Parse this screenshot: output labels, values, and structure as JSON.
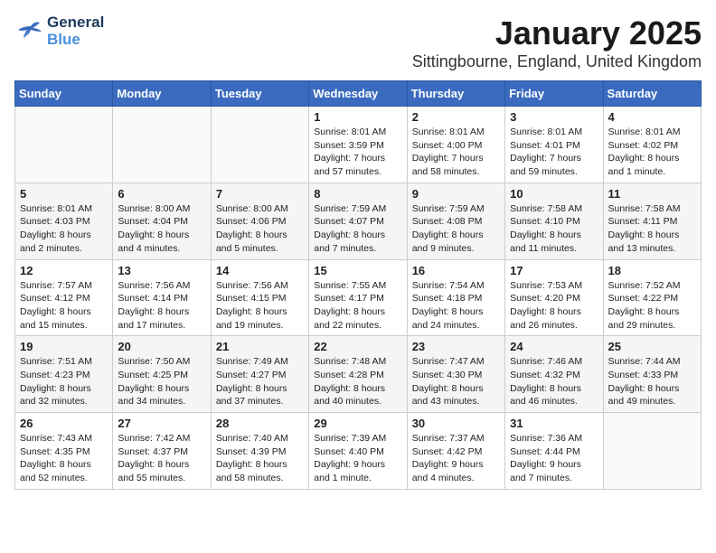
{
  "logo": {
    "line1": "General",
    "line2": "Blue"
  },
  "title": "January 2025",
  "location": "Sittingbourne, England, United Kingdom",
  "weekdays": [
    "Sunday",
    "Monday",
    "Tuesday",
    "Wednesday",
    "Thursday",
    "Friday",
    "Saturday"
  ],
  "weeks": [
    [
      {
        "day": "",
        "info": ""
      },
      {
        "day": "",
        "info": ""
      },
      {
        "day": "",
        "info": ""
      },
      {
        "day": "1",
        "info": "Sunrise: 8:01 AM\nSunset: 3:59 PM\nDaylight: 7 hours\nand 57 minutes."
      },
      {
        "day": "2",
        "info": "Sunrise: 8:01 AM\nSunset: 4:00 PM\nDaylight: 7 hours\nand 58 minutes."
      },
      {
        "day": "3",
        "info": "Sunrise: 8:01 AM\nSunset: 4:01 PM\nDaylight: 7 hours\nand 59 minutes."
      },
      {
        "day": "4",
        "info": "Sunrise: 8:01 AM\nSunset: 4:02 PM\nDaylight: 8 hours\nand 1 minute."
      }
    ],
    [
      {
        "day": "5",
        "info": "Sunrise: 8:01 AM\nSunset: 4:03 PM\nDaylight: 8 hours\nand 2 minutes."
      },
      {
        "day": "6",
        "info": "Sunrise: 8:00 AM\nSunset: 4:04 PM\nDaylight: 8 hours\nand 4 minutes."
      },
      {
        "day": "7",
        "info": "Sunrise: 8:00 AM\nSunset: 4:06 PM\nDaylight: 8 hours\nand 5 minutes."
      },
      {
        "day": "8",
        "info": "Sunrise: 7:59 AM\nSunset: 4:07 PM\nDaylight: 8 hours\nand 7 minutes."
      },
      {
        "day": "9",
        "info": "Sunrise: 7:59 AM\nSunset: 4:08 PM\nDaylight: 8 hours\nand 9 minutes."
      },
      {
        "day": "10",
        "info": "Sunrise: 7:58 AM\nSunset: 4:10 PM\nDaylight: 8 hours\nand 11 minutes."
      },
      {
        "day": "11",
        "info": "Sunrise: 7:58 AM\nSunset: 4:11 PM\nDaylight: 8 hours\nand 13 minutes."
      }
    ],
    [
      {
        "day": "12",
        "info": "Sunrise: 7:57 AM\nSunset: 4:12 PM\nDaylight: 8 hours\nand 15 minutes."
      },
      {
        "day": "13",
        "info": "Sunrise: 7:56 AM\nSunset: 4:14 PM\nDaylight: 8 hours\nand 17 minutes."
      },
      {
        "day": "14",
        "info": "Sunrise: 7:56 AM\nSunset: 4:15 PM\nDaylight: 8 hours\nand 19 minutes."
      },
      {
        "day": "15",
        "info": "Sunrise: 7:55 AM\nSunset: 4:17 PM\nDaylight: 8 hours\nand 22 minutes."
      },
      {
        "day": "16",
        "info": "Sunrise: 7:54 AM\nSunset: 4:18 PM\nDaylight: 8 hours\nand 24 minutes."
      },
      {
        "day": "17",
        "info": "Sunrise: 7:53 AM\nSunset: 4:20 PM\nDaylight: 8 hours\nand 26 minutes."
      },
      {
        "day": "18",
        "info": "Sunrise: 7:52 AM\nSunset: 4:22 PM\nDaylight: 8 hours\nand 29 minutes."
      }
    ],
    [
      {
        "day": "19",
        "info": "Sunrise: 7:51 AM\nSunset: 4:23 PM\nDaylight: 8 hours\nand 32 minutes."
      },
      {
        "day": "20",
        "info": "Sunrise: 7:50 AM\nSunset: 4:25 PM\nDaylight: 8 hours\nand 34 minutes."
      },
      {
        "day": "21",
        "info": "Sunrise: 7:49 AM\nSunset: 4:27 PM\nDaylight: 8 hours\nand 37 minutes."
      },
      {
        "day": "22",
        "info": "Sunrise: 7:48 AM\nSunset: 4:28 PM\nDaylight: 8 hours\nand 40 minutes."
      },
      {
        "day": "23",
        "info": "Sunrise: 7:47 AM\nSunset: 4:30 PM\nDaylight: 8 hours\nand 43 minutes."
      },
      {
        "day": "24",
        "info": "Sunrise: 7:46 AM\nSunset: 4:32 PM\nDaylight: 8 hours\nand 46 minutes."
      },
      {
        "day": "25",
        "info": "Sunrise: 7:44 AM\nSunset: 4:33 PM\nDaylight: 8 hours\nand 49 minutes."
      }
    ],
    [
      {
        "day": "26",
        "info": "Sunrise: 7:43 AM\nSunset: 4:35 PM\nDaylight: 8 hours\nand 52 minutes."
      },
      {
        "day": "27",
        "info": "Sunrise: 7:42 AM\nSunset: 4:37 PM\nDaylight: 8 hours\nand 55 minutes."
      },
      {
        "day": "28",
        "info": "Sunrise: 7:40 AM\nSunset: 4:39 PM\nDaylight: 8 hours\nand 58 minutes."
      },
      {
        "day": "29",
        "info": "Sunrise: 7:39 AM\nSunset: 4:40 PM\nDaylight: 9 hours\nand 1 minute."
      },
      {
        "day": "30",
        "info": "Sunrise: 7:37 AM\nSunset: 4:42 PM\nDaylight: 9 hours\nand 4 minutes."
      },
      {
        "day": "31",
        "info": "Sunrise: 7:36 AM\nSunset: 4:44 PM\nDaylight: 9 hours\nand 7 minutes."
      },
      {
        "day": "",
        "info": ""
      }
    ]
  ]
}
